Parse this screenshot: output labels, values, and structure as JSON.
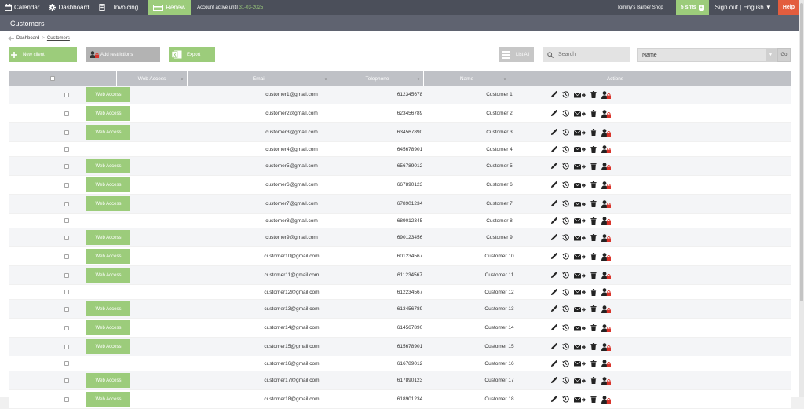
{
  "topbar": {
    "calendar": "Calendar",
    "dashboard": "Dashboard",
    "invoicing": "Invoicing",
    "renew": "Renew",
    "account_text": "Account active until",
    "account_date": "31-03-2025",
    "shop": "Tommy's Barber Shop",
    "sms": "5 sms",
    "sms_badge": "+",
    "signout": "Sign out | English ▼",
    "help": "Help"
  },
  "page_title": "Customers",
  "breadcrumb": {
    "home": "Dashboard",
    "sep": ">",
    "current": "Customers"
  },
  "toolbar": {
    "new_client": "New client",
    "add_restrictions": "Add restrictions",
    "export": "Export",
    "list_all": "List All",
    "search_placeholder": "Search",
    "sort_select": "Name",
    "go": "Go"
  },
  "table": {
    "columns": [
      "Web Access",
      "Email",
      "Telephone",
      "Name",
      "Actions"
    ],
    "web_access_label": "Web Access",
    "rows": [
      {
        "web": true,
        "email": "customer1@gmail.com",
        "tel": "612345678",
        "name": "Customer 1"
      },
      {
        "web": true,
        "email": "customer2@gmail.com",
        "tel": "623456789",
        "name": "Customer 2"
      },
      {
        "web": true,
        "email": "customer3@gmail.com",
        "tel": "634567890",
        "name": "Customer 3"
      },
      {
        "web": false,
        "email": "customer4@gmail.com",
        "tel": "645678901",
        "name": "Customer 4"
      },
      {
        "web": true,
        "email": "customer5@gmail.com",
        "tel": "656789012",
        "name": "Customer 5"
      },
      {
        "web": true,
        "email": "customer6@gmail.com",
        "tel": "667890123",
        "name": "Customer 6"
      },
      {
        "web": true,
        "email": "customer7@gmail.com",
        "tel": "678901234",
        "name": "Customer 7"
      },
      {
        "web": false,
        "email": "customer8@gmail.com",
        "tel": "689012345",
        "name": "Customer 8"
      },
      {
        "web": true,
        "email": "customer9@gmail.com",
        "tel": "690123456",
        "name": "Customer 9"
      },
      {
        "web": true,
        "email": "customer10@gmail.com",
        "tel": "601234567",
        "name": "Customer 10"
      },
      {
        "web": true,
        "email": "customer11@gmail.com",
        "tel": "611234567",
        "name": "Customer 11"
      },
      {
        "web": false,
        "email": "customer12@gmail.com",
        "tel": "612234567",
        "name": "Customer 12"
      },
      {
        "web": true,
        "email": "customer13@gmail.com",
        "tel": "613456789",
        "name": "Customer 13"
      },
      {
        "web": true,
        "email": "customer14@gmail.com",
        "tel": "614567890",
        "name": "Customer 14"
      },
      {
        "web": true,
        "email": "customer15@gmail.com",
        "tel": "615678901",
        "name": "Customer 15"
      },
      {
        "web": false,
        "email": "customer16@gmail.com",
        "tel": "616789012",
        "name": "Customer 16"
      },
      {
        "web": true,
        "email": "customer17@gmail.com",
        "tel": "617890123",
        "name": "Customer 17"
      },
      {
        "web": true,
        "email": "customer18@gmail.com",
        "tel": "618901234",
        "name": "Customer 18"
      }
    ]
  },
  "colors": {
    "topbar": "#4b4f5a",
    "green": "#9ccc7b",
    "help": "#e35d3e",
    "header": "#bfc1c6"
  },
  "icons": [
    "calendar-icon",
    "gear-icon",
    "document-icon",
    "plus-icon",
    "excel-icon",
    "list-icon",
    "search-icon",
    "pencil-icon",
    "history-icon",
    "email-arrow-icon",
    "trash-icon",
    "user-lock-icon"
  ]
}
